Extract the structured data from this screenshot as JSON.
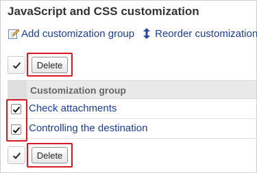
{
  "page_title": "JavaScript and CSS customization",
  "menu": {
    "add_label": "Add customization group",
    "reorder_label": "Reorder customization"
  },
  "toolbar_top": {
    "delete_label": "Delete"
  },
  "table": {
    "header": "Customization group",
    "rows": [
      {
        "name": "Check attachments",
        "checked": true
      },
      {
        "name": "Controlling the destination",
        "checked": true
      }
    ]
  },
  "toolbar_bottom": {
    "delete_label": "Delete"
  },
  "colors": {
    "link": "#1a3d9e",
    "highlight": "#e0141e",
    "header_bg": "#e9e9e9"
  },
  "icons": {
    "add": "add-customization-icon",
    "reorder": "reorder-icon",
    "check": "checkmark-icon"
  }
}
